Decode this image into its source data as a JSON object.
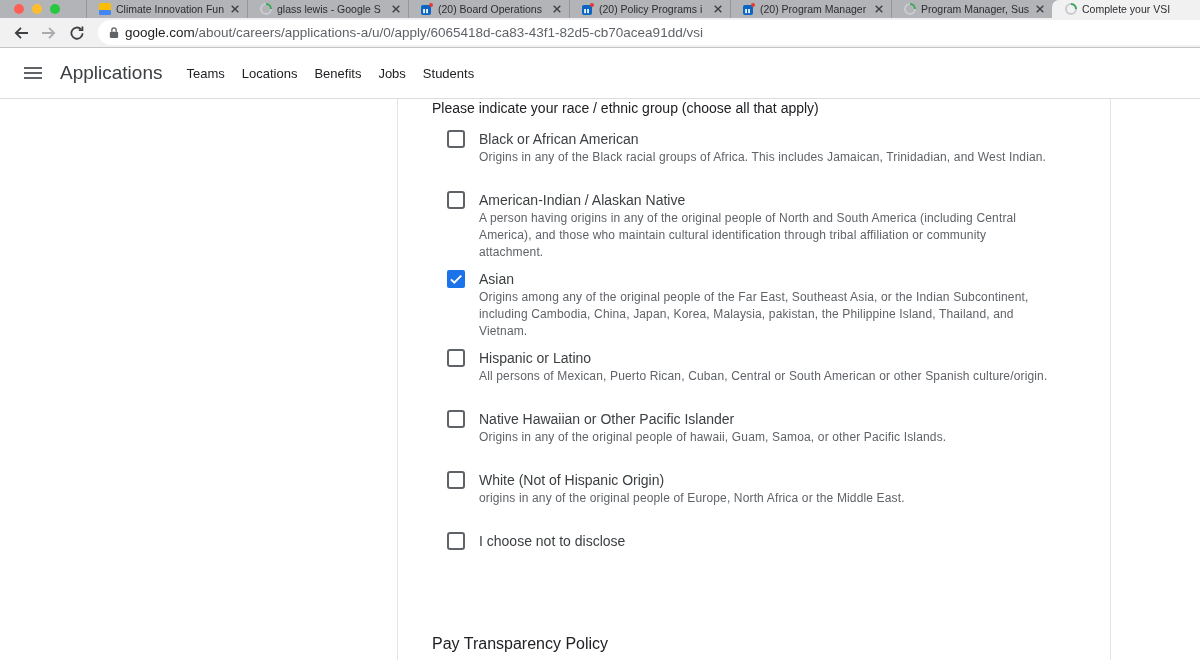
{
  "browser": {
    "tabs": [
      {
        "title": "Climate Innovation Fun",
        "kind": "tile",
        "selected": false,
        "close_button": true
      },
      {
        "title": "glass lewis - Google S",
        "kind": "ring",
        "selected": false,
        "close_button": true
      },
      {
        "title": "(20) Board Operations",
        "kind": "badge",
        "selected": false,
        "close_button": true
      },
      {
        "title": "(20) Policy Programs i",
        "kind": "badge",
        "selected": false,
        "close_button": true
      },
      {
        "title": "(20) Program Manager",
        "kind": "badge",
        "selected": false,
        "close_button": true
      },
      {
        "title": "Program Manager, Sus",
        "kind": "ring",
        "selected": false,
        "close_button": true
      },
      {
        "title": "Complete your VSI",
        "kind": "ring",
        "selected": true,
        "close_button": false
      }
    ],
    "nav_buttons": [
      {
        "kind": "back",
        "disabled": false
      },
      {
        "kind": "forward",
        "disabled": true
      },
      {
        "kind": "reload",
        "disabled": false
      }
    ],
    "address": {
      "host": "google.com",
      "path": "/about/careers/applications-a/u/0/apply/6065418d-ca83-43f1-82d5-cb70acea91dd/vsi"
    }
  },
  "header": {
    "title": "Applications",
    "links": [
      "Teams",
      "Locations",
      "Benefits",
      "Jobs",
      "Students"
    ]
  },
  "form": {
    "question": "Please indicate your race / ethnic group (choose all that apply)",
    "options": [
      {
        "label": "Black or African American",
        "description": "Origins in any of the Black racial groups of Africa. This includes Jamaican, Trinidadian, and West Indian.",
        "checked": false
      },
      {
        "label": "American-Indian / Alaskan Native",
        "description": "A person having origins in any of the original people of North and South America (including Central America), and those who maintain cultural identification through tribal affiliation or community attachment.",
        "checked": false
      },
      {
        "label": "Asian",
        "description": "Origins among any of the original people of the Far East, Southeast Asia, or the Indian Subcontinent, including Cambodia, China, Japan, Korea, Malaysia, pakistan, the Philippine Island, Thailand, and Vietnam.",
        "checked": true
      },
      {
        "label": "Hispanic or Latino",
        "description": "All persons of Mexican, Puerto Rican, Cuban, Central or South American or other Spanish culture/origin.",
        "checked": false
      },
      {
        "label": "Native Hawaiian or Other Pacific Islander",
        "description": "Origins in any of the original people of hawaii, Guam, Samoa, or other Pacific Islands.",
        "checked": false
      },
      {
        "label": "White (Not of Hispanic Origin)",
        "description": "origins in any of the original people of Europe, North Africa or the Middle East.",
        "checked": false
      },
      {
        "label": "I choose not to disclose",
        "checked": false
      }
    ],
    "next_section": "Pay Transparency Policy"
  }
}
